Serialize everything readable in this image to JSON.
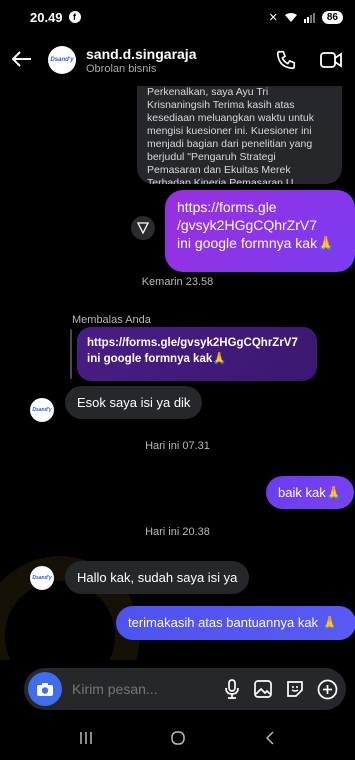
{
  "status": {
    "time": "20.49",
    "battery": "86"
  },
  "header": {
    "name": "sand.d.singaraja",
    "subtitle": "Obrolan bisnis",
    "avatar_text": "Dsand'y"
  },
  "messages": {
    "quoted_preview": "Perkenalkan, saya Ayu Tri Krisnaningsih Terima kasih atas kesediaan meluangkan waktu untuk mengisi kuesioner ini. Kuesioner ini menjadi bagian dari penelitian yang berjudul \"Pengaruh Strategi Pemasaran dan Ekuitas Merek Terhadap Kinerja Pemasaran U...",
    "link_message": "https://forms.gle/gvsyk2HGgCQhrZrV7 ini google formnya kak🙏",
    "link_url_line1": "https://forms.gle",
    "link_url_line2": "/gvsyk2HGgCQhrZrV7",
    "link_tail": "ini google formnya kak🙏",
    "ts_1": "Kemarin 23.58",
    "reply_label": "Membalas Anda",
    "reply_quote_line1": "https://forms.gle/gvsyk2HGgCQhrZrV7",
    "reply_quote_line2": "ini google formnya kak🙏",
    "msg_in_1": "Esok saya isi ya dik",
    "ts_2": "Hari ini 07.31",
    "msg_out_1": "baik kak🙏",
    "ts_3": "Hari ini 20.38",
    "msg_in_2": "Hallo kak, sudah saya isi ya",
    "msg_out_2": "terimakasih atas bantuannya kak 🙏"
  },
  "composer": {
    "placeholder": "Kirim pesan..."
  },
  "icons": {
    "back": "arrow-left-icon",
    "call": "phone-icon",
    "video": "video-icon",
    "share": "share-icon",
    "camera": "camera-icon",
    "mic": "mic-icon",
    "gallery": "image-icon",
    "sticker": "sticker-icon",
    "add": "plus-icon",
    "nav_recent": "recent-apps-icon",
    "nav_home": "home-icon",
    "nav_back": "back-icon"
  },
  "colors": {
    "accent_purple": "#9a2fe0",
    "accent_blue": "#4e52f0",
    "camera_blue": "#3f6df0",
    "bubble_in": "#26272b"
  }
}
